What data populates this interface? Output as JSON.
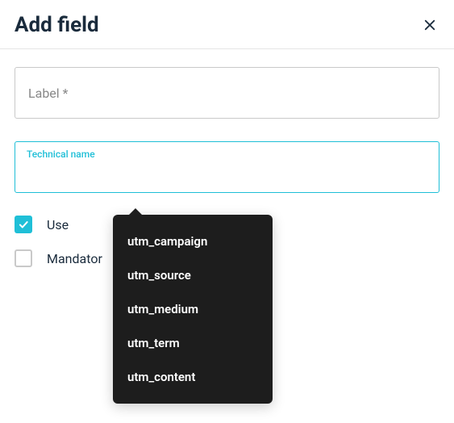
{
  "header": {
    "title": "Add field"
  },
  "form": {
    "label_field": {
      "label": "Label *",
      "value": ""
    },
    "technical_name_field": {
      "label": "Technical name",
      "value": ""
    }
  },
  "checkboxes": {
    "use": {
      "label": "Use",
      "checked": true
    },
    "mandatory": {
      "label": "Mandator",
      "checked": false
    }
  },
  "dropdown": {
    "items": [
      "utm_campaign",
      "utm_source",
      "utm_medium",
      "utm_term",
      "utm_content"
    ]
  },
  "colors": {
    "accent": "#1fbfd7",
    "text_dark": "#1a2b3c",
    "dropdown_bg": "#1d1d1d"
  }
}
